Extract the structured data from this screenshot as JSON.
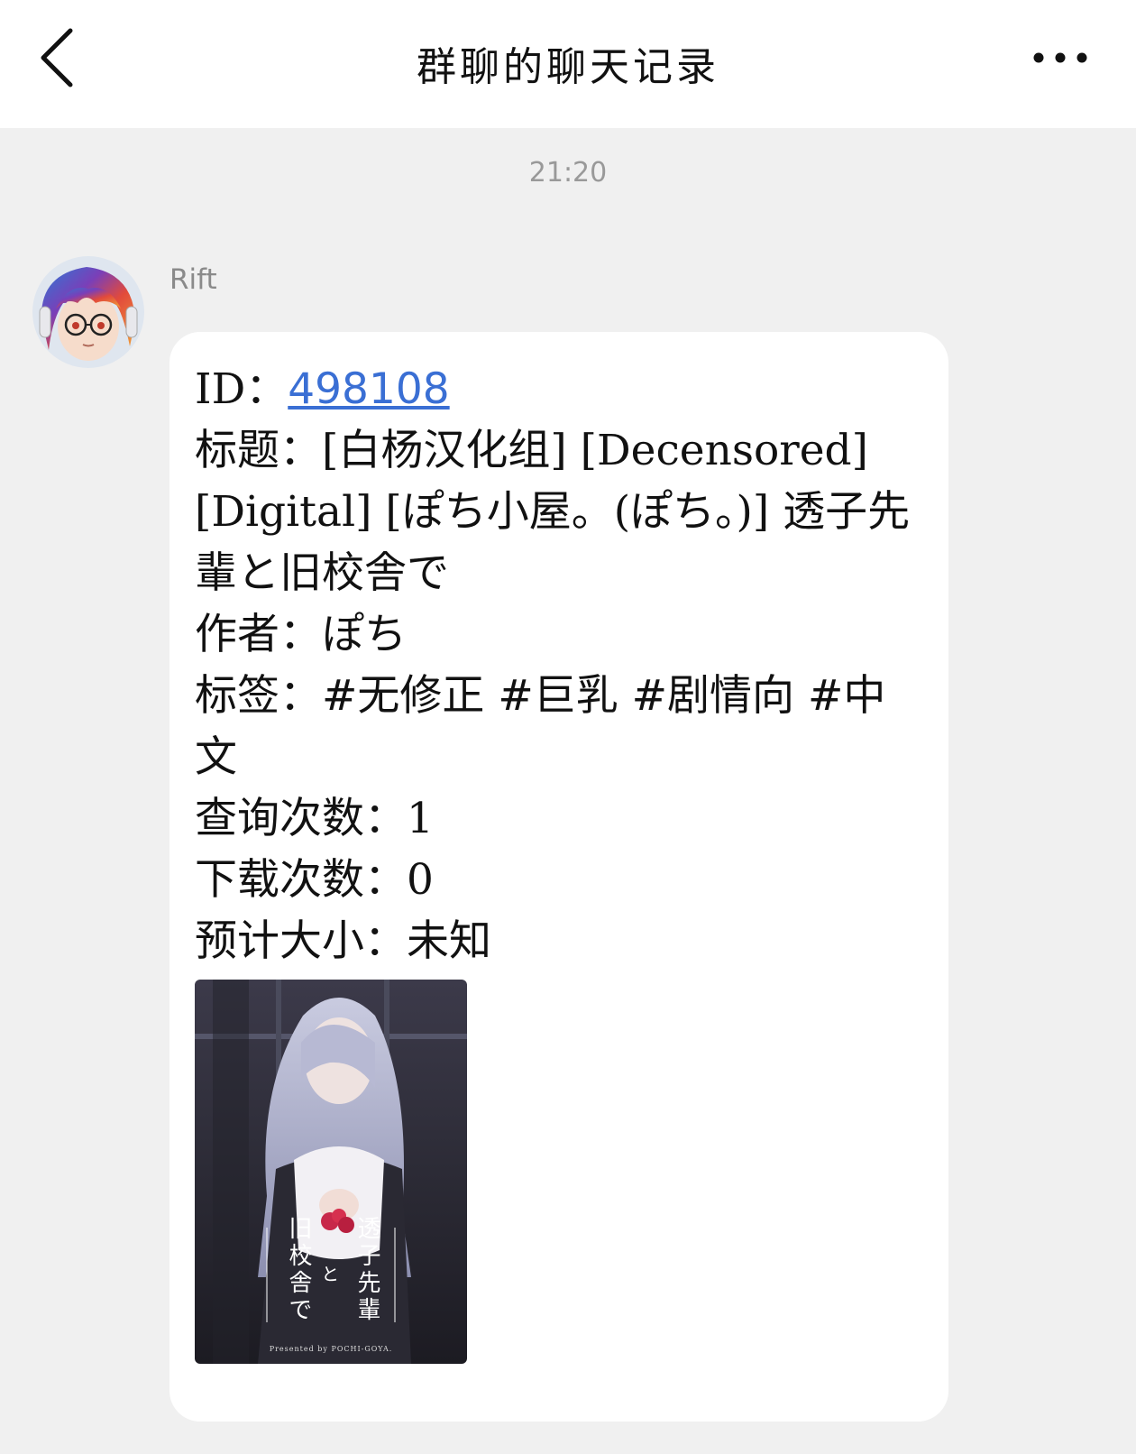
{
  "header": {
    "title": "群聊的聊天记录",
    "back_icon": "chevron-left-icon",
    "more_icon": "more-dots-icon"
  },
  "timestamp": "21:20",
  "message": {
    "sender": "Rift",
    "id_label": "ID：",
    "id_value": "498108",
    "title_label": "标题：",
    "title_value": "[白杨汉化组] [Decensored] [Digital] [ぽち小屋。(ぽち。)] 透子先輩と旧校舎で",
    "author_label": "作者：",
    "author_value": "ぽち",
    "tags_label": "标签：",
    "tags_value": "#无修正 #巨乳 #剧情向 #中文",
    "query_label": "查询次数：",
    "query_value": "1",
    "download_label": "下载次数：",
    "download_value": "0",
    "size_label": "预计大小：",
    "size_value": "未知"
  },
  "cover": {
    "title_right": "透子先輩",
    "title_mid": "と",
    "title_left": "旧校舎で",
    "credit": "Presented by POCHI-GOYA."
  },
  "colors": {
    "background": "#f0f0f0",
    "bubble": "#ffffff",
    "link": "#3a6fd4"
  }
}
